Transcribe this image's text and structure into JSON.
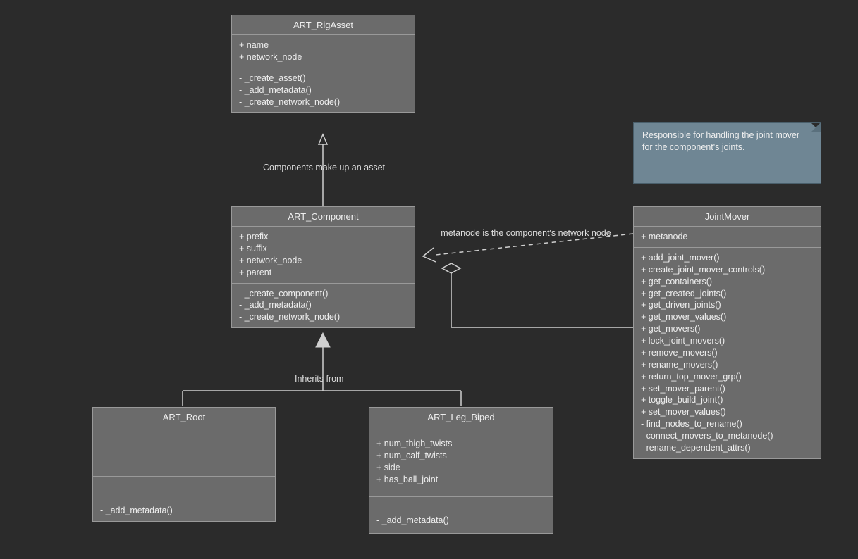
{
  "classes": {
    "rigAsset": {
      "name": "ART_RigAsset",
      "attrs": [
        "+ name",
        "+ network_node"
      ],
      "ops": [
        "- _create_asset()",
        "- _add_metadata()",
        "- _create_network_node()"
      ]
    },
    "component": {
      "name": "ART_Component",
      "attrs": [
        "+ prefix",
        "+ suffix",
        "+ network_node",
        "+ parent"
      ],
      "ops": [
        "- _create_component()",
        "- _add_metadata()",
        "- _create_network_node()"
      ]
    },
    "root": {
      "name": "ART_Root",
      "attrs": [],
      "ops": [
        "- _add_metadata()"
      ]
    },
    "legBiped": {
      "name": "ART_Leg_Biped",
      "attrs": [
        "+ num_thigh_twists",
        "+ num_calf_twists",
        "+ side",
        "+ has_ball_joint"
      ],
      "ops": [
        "- _add_metadata()"
      ]
    },
    "jointMover": {
      "name": "JointMover",
      "attrs": [
        "+ metanode"
      ],
      "ops": [
        "+ add_joint_mover()",
        "+ create_joint_mover_controls()",
        "+ get_containers()",
        "+ get_created_joints()",
        "+ get_driven_joints()",
        "+ get_mover_values()",
        "+ get_movers()",
        "+ lock_joint_movers()",
        "+ remove_movers()",
        "+ rename_movers()",
        "+ return_top_mover_grp()",
        "+ set_mover_parent()",
        "+ toggle_build_joint()",
        "+ set_mover_values()",
        "- find_nodes_to_rename()",
        "- connect_movers_to_metanode()",
        "- rename_dependent_attrs()"
      ]
    }
  },
  "note": {
    "text": "Responsible for handling the joint mover for the component's joints."
  },
  "labels": {
    "compToAsset": "Components make up an asset",
    "inherits": "Inherits from",
    "metanode": "metanode is the component's network node"
  }
}
